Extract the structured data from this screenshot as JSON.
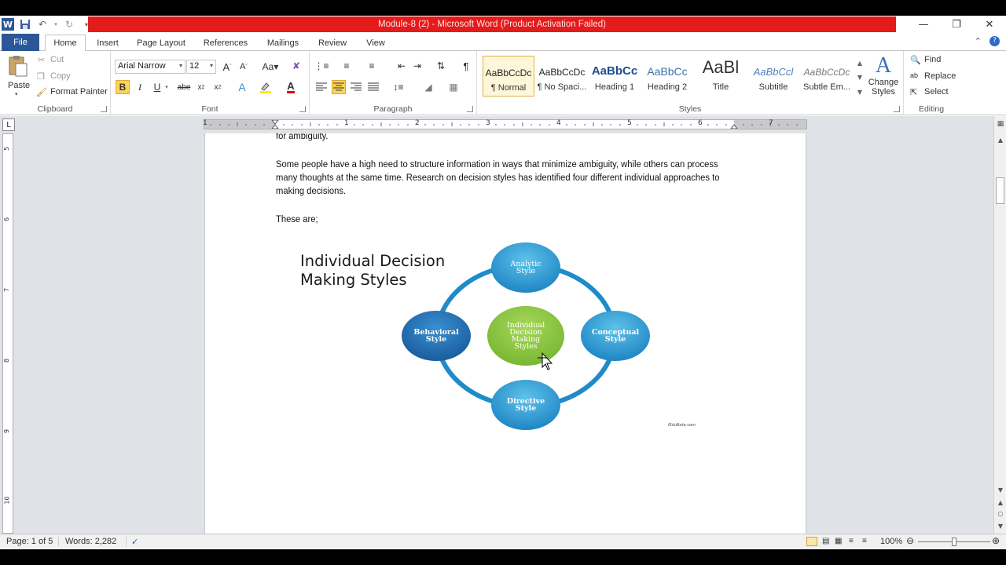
{
  "window": {
    "title": "Module-8 (2)  -  Microsoft Word (Product Activation Failed)",
    "title_bar_color": "#e31b1b"
  },
  "tabs": {
    "file": "File",
    "home": "Home",
    "insert": "Insert",
    "page_layout": "Page Layout",
    "references": "References",
    "mailings": "Mailings",
    "review": "Review",
    "view": "View"
  },
  "clipboard": {
    "paste": "Paste",
    "cut": "Cut",
    "copy": "Copy",
    "format_painter": "Format Painter",
    "label": "Clipboard"
  },
  "font": {
    "family": "Arial Narrow",
    "size": "12",
    "label": "Font"
  },
  "paragraph": {
    "label": "Paragraph"
  },
  "styles": {
    "label": "Styles",
    "items": [
      {
        "preview": "AaBbCcDc",
        "name": "¶ Normal"
      },
      {
        "preview": "AaBbCcDc",
        "name": "¶ No Spaci..."
      },
      {
        "preview": "AaBbCc",
        "name": "Heading 1"
      },
      {
        "preview": "AaBbCc",
        "name": "Heading 2"
      },
      {
        "preview": "AaBl",
        "name": "Title"
      },
      {
        "preview": "AaBbCcl",
        "name": "Subtitle"
      },
      {
        "preview": "AaBbCcDc",
        "name": "Subtle Em..."
      }
    ],
    "change_styles": "Change Styles"
  },
  "editing": {
    "find": "Find",
    "replace": "Replace",
    "select": "Select",
    "label": "Editing"
  },
  "ruler": {
    "marks": [
      "1",
      "1",
      "2",
      "3",
      "4",
      "5",
      "6",
      "7"
    ]
  },
  "vruler": {
    "marks": [
      "5",
      "6",
      "7",
      "8",
      "9",
      "10"
    ]
  },
  "document": {
    "line_top": "for ambiguity.",
    "paragraph_1": "Some people have a high need to structure information in ways that minimize ambiguity, while others can process many thoughts at the same time. Research on decision styles has identified four different individual approaches to making decisions.",
    "paragraph_2": "These are;"
  },
  "diagram": {
    "title_line1": "Individual Decision",
    "title_line2": "Making Styles",
    "center": [
      "Individual",
      "Decision",
      "Making",
      "Styles"
    ],
    "top": [
      "Analytic",
      "Style"
    ],
    "left": [
      "Behavioral",
      "Style"
    ],
    "right": [
      "Conceptual",
      "Style"
    ],
    "bottom": [
      "Directive",
      "Style"
    ],
    "source": "iEduNote.com",
    "center_color": "#8dc63f",
    "node_color": "#2a8cc7",
    "ring_color": "#1f8bc9"
  },
  "status": {
    "page": "Page: 1 of 5",
    "words": "Words: 2,282",
    "zoom": "100%"
  }
}
